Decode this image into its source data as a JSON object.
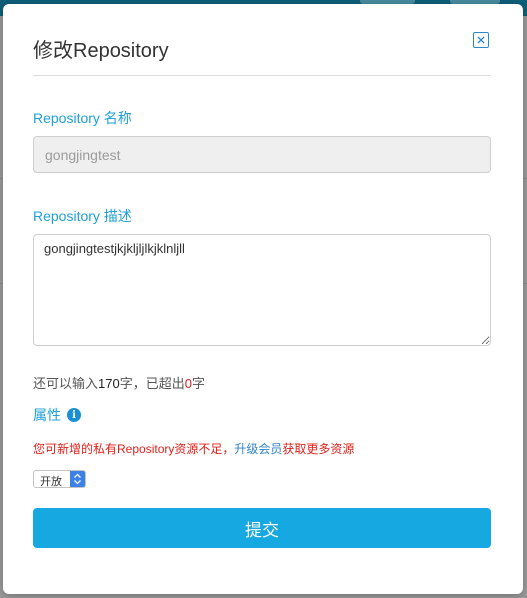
{
  "modal": {
    "title": "修改Repository",
    "name_label": "Repository 名称",
    "name_value": "gongjingtest",
    "desc_label": "Repository 描述",
    "desc_value": "gongjingtestjkjkljljlkjklnljll",
    "counter": {
      "prefix": "还可以输入",
      "remaining": "170",
      "middle": "字，已超出",
      "exceeded": "0",
      "suffix": "字"
    },
    "attr_label": "属性",
    "info_icon_glyph": "i",
    "warning": {
      "text": "您可新增的私有Repository资源不足，",
      "link": "升级会员",
      "tail": "获取更多资源"
    },
    "visibility_select": {
      "selected": "开放"
    },
    "submit_label": "提交"
  },
  "colors": {
    "accent": "#16a9e1",
    "label": "#1fa0d6",
    "warning": "#e0201b",
    "link": "#2f86c6"
  }
}
